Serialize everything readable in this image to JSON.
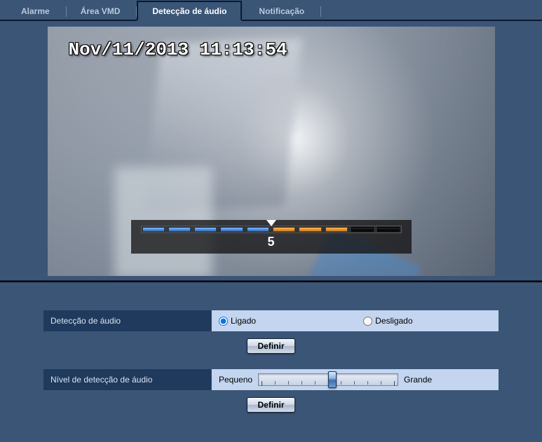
{
  "tabs": {
    "alarme": "Alarme",
    "area_vmd": "Área VMD",
    "audio_detect": "Detecção de áudio",
    "notificacao": "Notificação"
  },
  "video": {
    "timestamp": "Nov/11/2013  11:13:54",
    "level_value": "5",
    "pointer_segment": 5,
    "total_segments": 10
  },
  "form": {
    "audio_detect_label": "Detecção de áudio",
    "on_label": "Ligado",
    "off_label": "Desligado",
    "define_button": "Definir",
    "level_label": "Nível de detecção de áudio",
    "small_label": "Pequeno",
    "large_label": "Grande",
    "slider_percent": 53
  }
}
